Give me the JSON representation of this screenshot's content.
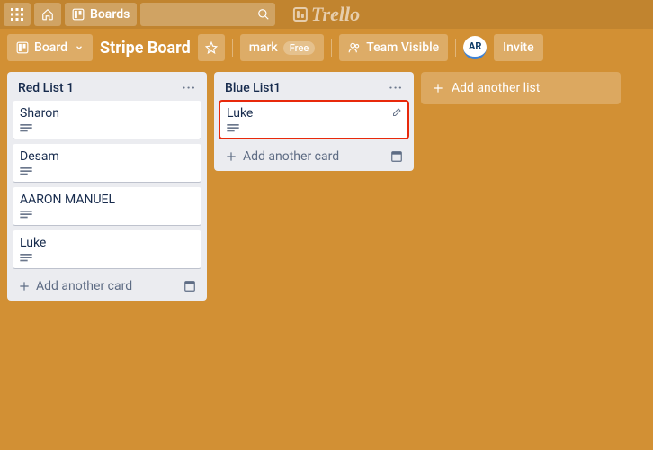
{
  "topbar": {
    "boards_label": "Boards",
    "brand": "Trello"
  },
  "boardbar": {
    "board_switcher": "Board",
    "title": "Stripe Board",
    "user": "mark",
    "plan": "Free",
    "visibility": "Team Visible",
    "avatar_initials": "AR",
    "invite": "Invite"
  },
  "lists": [
    {
      "title": "Red List 1",
      "cards": [
        {
          "title": "Sharon",
          "has_desc": true
        },
        {
          "title": "Desam",
          "has_desc": true
        },
        {
          "title": "AARON MANUEL",
          "has_desc": true
        },
        {
          "title": "Luke",
          "has_desc": true
        }
      ],
      "add_label": "Add another card"
    },
    {
      "title": "Blue List1",
      "cards": [
        {
          "title": "Luke",
          "has_desc": true,
          "highlight": true,
          "show_edit": true
        }
      ],
      "add_label": "Add another card"
    }
  ],
  "add_list_label": "Add another list"
}
